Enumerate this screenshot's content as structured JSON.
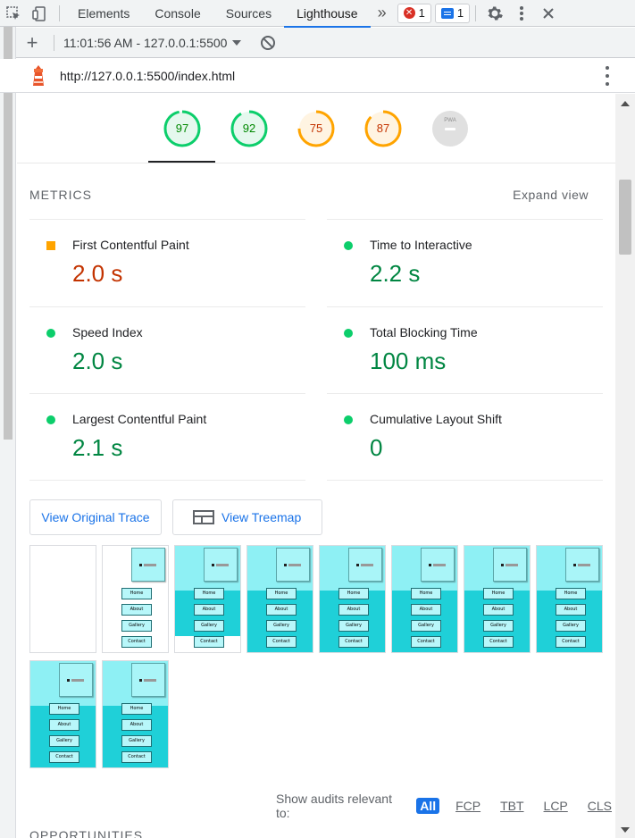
{
  "devtools": {
    "tabs": [
      {
        "label": "Elements"
      },
      {
        "label": "Console"
      },
      {
        "label": "Sources"
      },
      {
        "label": "Lighthouse"
      }
    ],
    "more_label": "»",
    "error_count": "1",
    "message_count": "1"
  },
  "toolbar": {
    "add_label": "+",
    "report_label": "11:01:56 AM - 127.0.0.1:5500"
  },
  "url_bar": {
    "url": "http://127.0.0.1:5500/index.html"
  },
  "gauges": [
    {
      "value": "97",
      "score": 0.97,
      "color": "#0cce6b",
      "bg": "#e5f8ee",
      "text_color": "#008800"
    },
    {
      "value": "92",
      "score": 0.92,
      "color": "#0cce6b",
      "bg": "#e5f8ee",
      "text_color": "#008800"
    },
    {
      "value": "75",
      "score": 0.75,
      "color": "#ffa400",
      "bg": "#fff4e2",
      "text_color": "#c33300"
    },
    {
      "value": "87",
      "score": 0.87,
      "color": "#ffa400",
      "bg": "#fff4e2",
      "text_color": "#c33300"
    },
    {
      "value": "PWA",
      "score": 0,
      "color": "#d3d3d3",
      "bg": "#e0e0e0",
      "text_color": "#8c8c8c"
    }
  ],
  "metrics": {
    "title": "METRICS",
    "expand_label": "Expand view",
    "items": [
      {
        "label": "First Contentful Paint",
        "value": "2.0 s",
        "status": "average"
      },
      {
        "label": "Time to Interactive",
        "value": "2.2 s",
        "status": "pass"
      },
      {
        "label": "Speed Index",
        "value": "2.0 s",
        "status": "pass"
      },
      {
        "label": "Total Blocking Time",
        "value": "100 ms",
        "status": "pass"
      },
      {
        "label": "Largest Contentful Paint",
        "value": "2.1 s",
        "status": "pass"
      },
      {
        "label": "Cumulative Layout Shift",
        "value": "0",
        "status": "pass"
      }
    ]
  },
  "buttons": {
    "trace_label": "View Original Trace",
    "treemap_label": "View Treemap"
  },
  "filmstrip": {
    "nav_labels": [
      "Home",
      "About",
      "Gallery",
      "Contact"
    ],
    "frames": [
      {
        "state": "blank"
      },
      {
        "state": "partial"
      },
      {
        "state": "loading"
      },
      {
        "state": "full"
      },
      {
        "state": "full"
      },
      {
        "state": "full"
      },
      {
        "state": "full"
      },
      {
        "state": "full"
      },
      {
        "state": "full"
      },
      {
        "state": "full"
      }
    ]
  },
  "audit_filter": {
    "label": "Show audits relevant to:",
    "options": [
      "All",
      "FCP",
      "TBT",
      "LCP",
      "CLS"
    ],
    "selected": "All"
  },
  "next_section_title": "OPPORTUNITIES"
}
